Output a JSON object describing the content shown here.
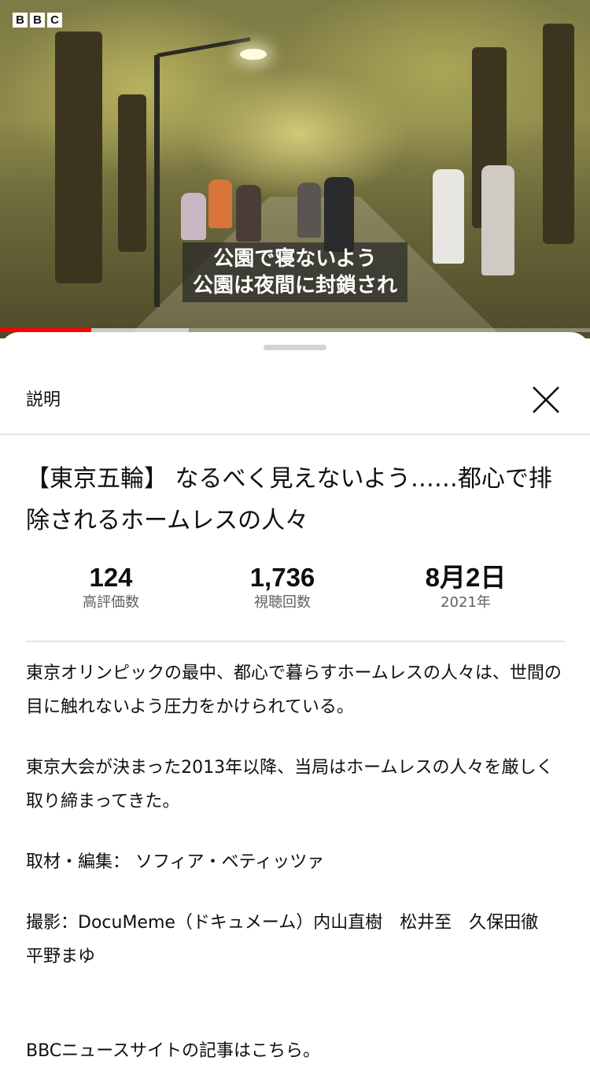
{
  "video": {
    "channel_logo": [
      "B",
      "B",
      "C"
    ],
    "subtitle_line1": "公園で寝ないよう",
    "subtitle_line2": "公園は夜間に封鎖され",
    "progress_played": 0.155,
    "progress_buffered": 0.32,
    "colors": {
      "progress": "#ff0000"
    }
  },
  "sheet": {
    "title": "説明",
    "close_icon": "close-icon"
  },
  "description": {
    "video_title": "【東京五輪】 なるべく見えないよう……都心で排除されるホームレスの人々",
    "stats": [
      {
        "value": "124",
        "label": "高評価数"
      },
      {
        "value": "1,736",
        "label": "視聴回数"
      },
      {
        "value": "8月2日",
        "label": "2021年"
      }
    ],
    "paragraphs": [
      "東京オリンピックの最中、都心で暮らすホームレスの人々は、世間の目に触れないよう圧力をかけられている。",
      "東京大会が決まった2013年以降、当局はホームレスの人々を厳しく取り締まってきた。",
      "取材・編集： ソフィア・ベティッツァ",
      "撮影：DocuMeme（ドキュメーム）内山直樹　松井至　久保田徹　平野まゆ",
      "BBCニュースサイトの記事はこちら。"
    ]
  }
}
